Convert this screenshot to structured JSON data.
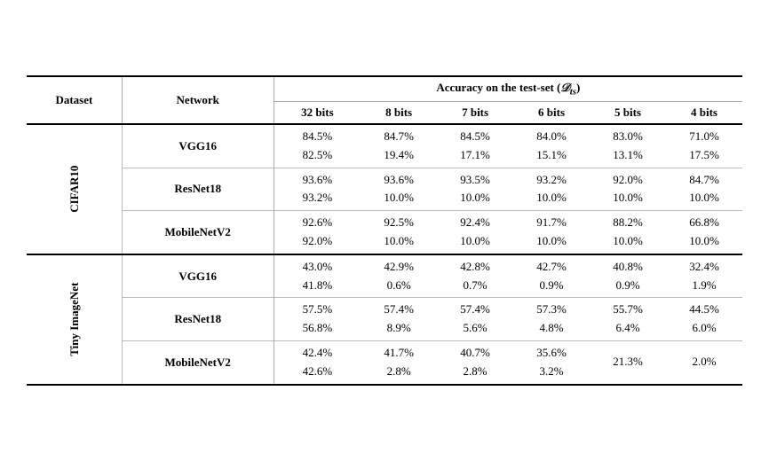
{
  "table": {
    "headers": {
      "dataset": "Dataset",
      "network": "Network",
      "accuracy_label": "Accuracy on the test-set",
      "accuracy_sub": "(D_ts)",
      "bits": [
        "32 bits",
        "8 bits",
        "7 bits",
        "6 bits",
        "5 bits",
        "4 bits"
      ]
    },
    "sections": [
      {
        "dataset": "CIFAR10",
        "rows": [
          {
            "network": "VGG16",
            "values": [
              {
                "line1": "84.5%",
                "line2": "82.5%"
              },
              {
                "line1": "84.7%",
                "line2": "19.4%"
              },
              {
                "line1": "84.5%",
                "line2": "17.1%"
              },
              {
                "line1": "84.0%",
                "line2": "15.1%"
              },
              {
                "line1": "83.0%",
                "line2": "13.1%"
              },
              {
                "line1": "71.0%",
                "line2": "17.5%"
              }
            ]
          },
          {
            "network": "ResNet18",
            "values": [
              {
                "line1": "93.6%",
                "line2": "93.2%"
              },
              {
                "line1": "93.6%",
                "line2": "10.0%"
              },
              {
                "line1": "93.5%",
                "line2": "10.0%"
              },
              {
                "line1": "93.2%",
                "line2": "10.0%"
              },
              {
                "line1": "92.0%",
                "line2": "10.0%"
              },
              {
                "line1": "84.7%",
                "line2": "10.0%"
              }
            ]
          },
          {
            "network": "MobileNetV2",
            "values": [
              {
                "line1": "92.6%",
                "line2": "92.0%"
              },
              {
                "line1": "92.5%",
                "line2": "10.0%"
              },
              {
                "line1": "92.4%",
                "line2": "10.0%"
              },
              {
                "line1": "91.7%",
                "line2": "10.0%"
              },
              {
                "line1": "88.2%",
                "line2": "10.0%"
              },
              {
                "line1": "66.8%",
                "line2": "10.0%"
              }
            ]
          }
        ]
      },
      {
        "dataset": "Tiny ImageNet",
        "rows": [
          {
            "network": "VGG16",
            "values": [
              {
                "line1": "43.0%",
                "line2": "41.8%"
              },
              {
                "line1": "42.9%",
                "line2": "0.6%"
              },
              {
                "line1": "42.8%",
                "line2": "0.7%"
              },
              {
                "line1": "42.7%",
                "line2": "0.9%"
              },
              {
                "line1": "40.8%",
                "line2": "0.9%"
              },
              {
                "line1": "32.4%",
                "line2": "1.9%"
              }
            ]
          },
          {
            "network": "ResNet18",
            "values": [
              {
                "line1": "57.5%",
                "line2": "56.8%"
              },
              {
                "line1": "57.4%",
                "line2": "8.9%"
              },
              {
                "line1": "57.4%",
                "line2": "5.6%"
              },
              {
                "line1": "57.3%",
                "line2": "4.8%"
              },
              {
                "line1": "55.7%",
                "line2": "6.4%"
              },
              {
                "line1": "44.5%",
                "line2": "6.0%"
              }
            ]
          },
          {
            "network": "MobileNetV2",
            "values": [
              {
                "line1": "42.4%",
                "line2": "42.6%"
              },
              {
                "line1": "41.7%",
                "line2": "2.8%"
              },
              {
                "line1": "40.7%",
                "line2": "2.8%"
              },
              {
                "line1": "35.6%",
                "line2": "3.2%"
              },
              {
                "line1": "21.3%",
                "line2": ""
              },
              {
                "line1": "2.0%",
                "line2": ""
              }
            ]
          }
        ]
      }
    ]
  }
}
